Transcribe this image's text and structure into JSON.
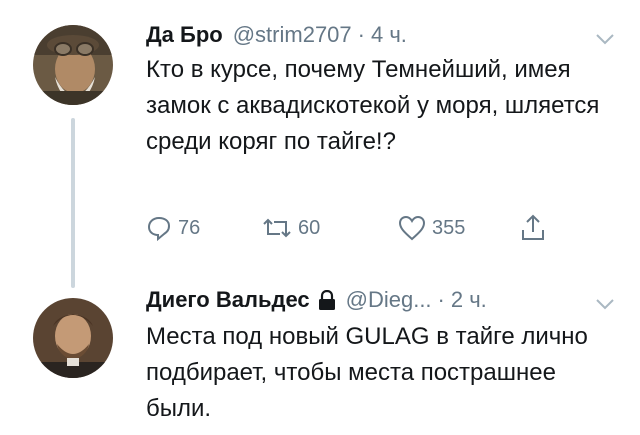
{
  "tweets": [
    {
      "name": "Да Бро",
      "handle": "@strim2707",
      "dot": "·",
      "time": "4 ч.",
      "text": "Кто в курсе, почему Темнейший, имея замок с аквадискотекой у моря, шляется среди коряг по тайге!?",
      "reply_count": "76",
      "retweet_count": "60",
      "like_count": "355"
    },
    {
      "name": "Диего Вальдес",
      "handle": "@Dieg...",
      "dot": "·",
      "time": "2 ч.",
      "text": "Места под новый GULAG в тайге лично подбирает, чтобы места пострашнее были."
    }
  ],
  "icons": {
    "reply": "reply-icon",
    "retweet": "retweet-icon",
    "like": "heart-icon",
    "share": "share-icon",
    "lock": "lock-icon",
    "chevron": "chevron-down-icon"
  },
  "colors": {
    "text": "#14171a",
    "secondary": "#657786",
    "thread_line": "#ccd6dd"
  }
}
